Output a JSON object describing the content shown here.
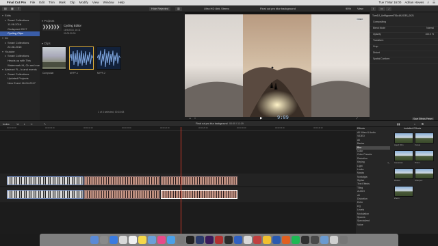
{
  "menubar": {
    "apple": "",
    "items": [
      "Final Cut Pro",
      "File",
      "Edit",
      "Trim",
      "Mark",
      "Clip",
      "Modify",
      "View",
      "Window",
      "Help"
    ],
    "clock": "Tue 7 Mar 16:00",
    "user": "Adrian Howes"
  },
  "toolbar": {
    "hide_rejected": "Hide Rejected",
    "viewer_title": "Ultra HD 8bit, Stereo",
    "viewer_clip": "Final cut pro blur background",
    "zoom": "95%",
    "view": "View"
  },
  "libraries": {
    "items": [
      {
        "label": "Edits",
        "indent": 0,
        "tri": "▾"
      },
      {
        "label": "Smart Collections",
        "indent": 1,
        "tri": "▸"
      },
      {
        "label": "11-08-2016",
        "indent": 1,
        "tri": ""
      },
      {
        "label": "Godspeed 2017",
        "indent": 1,
        "tri": ""
      },
      {
        "label": "Cycling Clips",
        "indent": 1,
        "tri": "",
        "selected": true
      },
      {
        "label": "DJ",
        "indent": 0,
        "tri": "▾"
      },
      {
        "label": "Smart Collections",
        "indent": 1,
        "tri": "▸"
      },
      {
        "label": "22-08-2016",
        "indent": 1,
        "tri": ""
      },
      {
        "label": "Youtube",
        "indent": 0,
        "tri": "▾"
      },
      {
        "label": "Smart Collections",
        "indent": 1,
        "tri": "▸"
      },
      {
        "label": "Heads up with This",
        "indent": 1,
        "tri": ""
      },
      {
        "label": "Watermark Hi, Cb and events",
        "indent": 1,
        "tri": ""
      },
      {
        "label": "Abstract FL, Io and events",
        "indent": 0,
        "tri": "▾"
      },
      {
        "label": "Smart Collections",
        "indent": 1,
        "tri": "▸"
      },
      {
        "label": "Updated Projects",
        "indent": 1,
        "tri": ""
      },
      {
        "label": "New Event 16-04-2017",
        "indent": 1,
        "tri": ""
      }
    ]
  },
  "browser": {
    "projects_label": "Projects",
    "project_name": "Cycling Editor",
    "project_date": "16/5/2016, 16:11",
    "project_duration": "00:00:30:00",
    "clips_label": "Clips",
    "clips": [
      {
        "label": "Comprobar"
      },
      {
        "label": "MYFF-1"
      },
      {
        "label": "MYFF-2"
      }
    ],
    "footer": "1 of 4 selected, 00:15:08"
  },
  "viewer": {
    "timecode": "9:09",
    "badge": "VIDEO"
  },
  "inspector": {
    "file": "TurnDJ_Unf9pparenT51u4AXO3S_0021",
    "rows": [
      {
        "label": "Compositing",
        "value": ""
      },
      {
        "label": "Blend Mode",
        "value": "Normal"
      },
      {
        "label": "Opacity",
        "value": "100.0 %"
      },
      {
        "label": "Transform",
        "value": ""
      },
      {
        "label": "Crop",
        "value": ""
      },
      {
        "label": "Distort",
        "value": ""
      },
      {
        "label": "Spatial Conform",
        "value": ""
      }
    ],
    "save_button": "Save Effects Preset"
  },
  "timeline_bar": {
    "index": "Index",
    "clip_title": "Final cut pro blur background",
    "clip_time": "00:00 / 11:19",
    "installed": "Installed Effects"
  },
  "ruler": [
    "00:00:00:00",
    "00:00:05:00",
    "00:00:10:00",
    "00:00:15:00",
    "00:00:20:00",
    "00:00:25:00",
    "00:00:30:00",
    "00:00:35:00",
    "00:00:40:00"
  ],
  "effects": {
    "header": "Effects",
    "categories": [
      "All Video & Audio",
      "VIDEO",
      "All",
      "Basics",
      "Blur",
      "Color",
      "Color Presets",
      "Distortion",
      "Keying",
      "Light",
      "Looks",
      "Masks",
      "Nostalgia",
      "Stylize",
      "Text Effects",
      "Tiling",
      "AUDIO",
      "All",
      "Distortion",
      "Echo",
      "EQ",
      "Levels",
      "Modulation",
      "Spaces",
      "Specialized",
      "Voice"
    ],
    "selected_index": 4,
    "thumbs": [
      {
        "label": "Aged Film"
      },
      {
        "label": "Focus"
      },
      {
        "label": "Gaussian"
      },
      {
        "label": "Prism"
      },
      {
        "label": "Radial"
      },
      {
        "label": "Sharpen"
      },
      {
        "label": "Zoom"
      }
    ]
  },
  "colors": {
    "accent": "#3a5da8",
    "playhead": "#d03a2a"
  }
}
